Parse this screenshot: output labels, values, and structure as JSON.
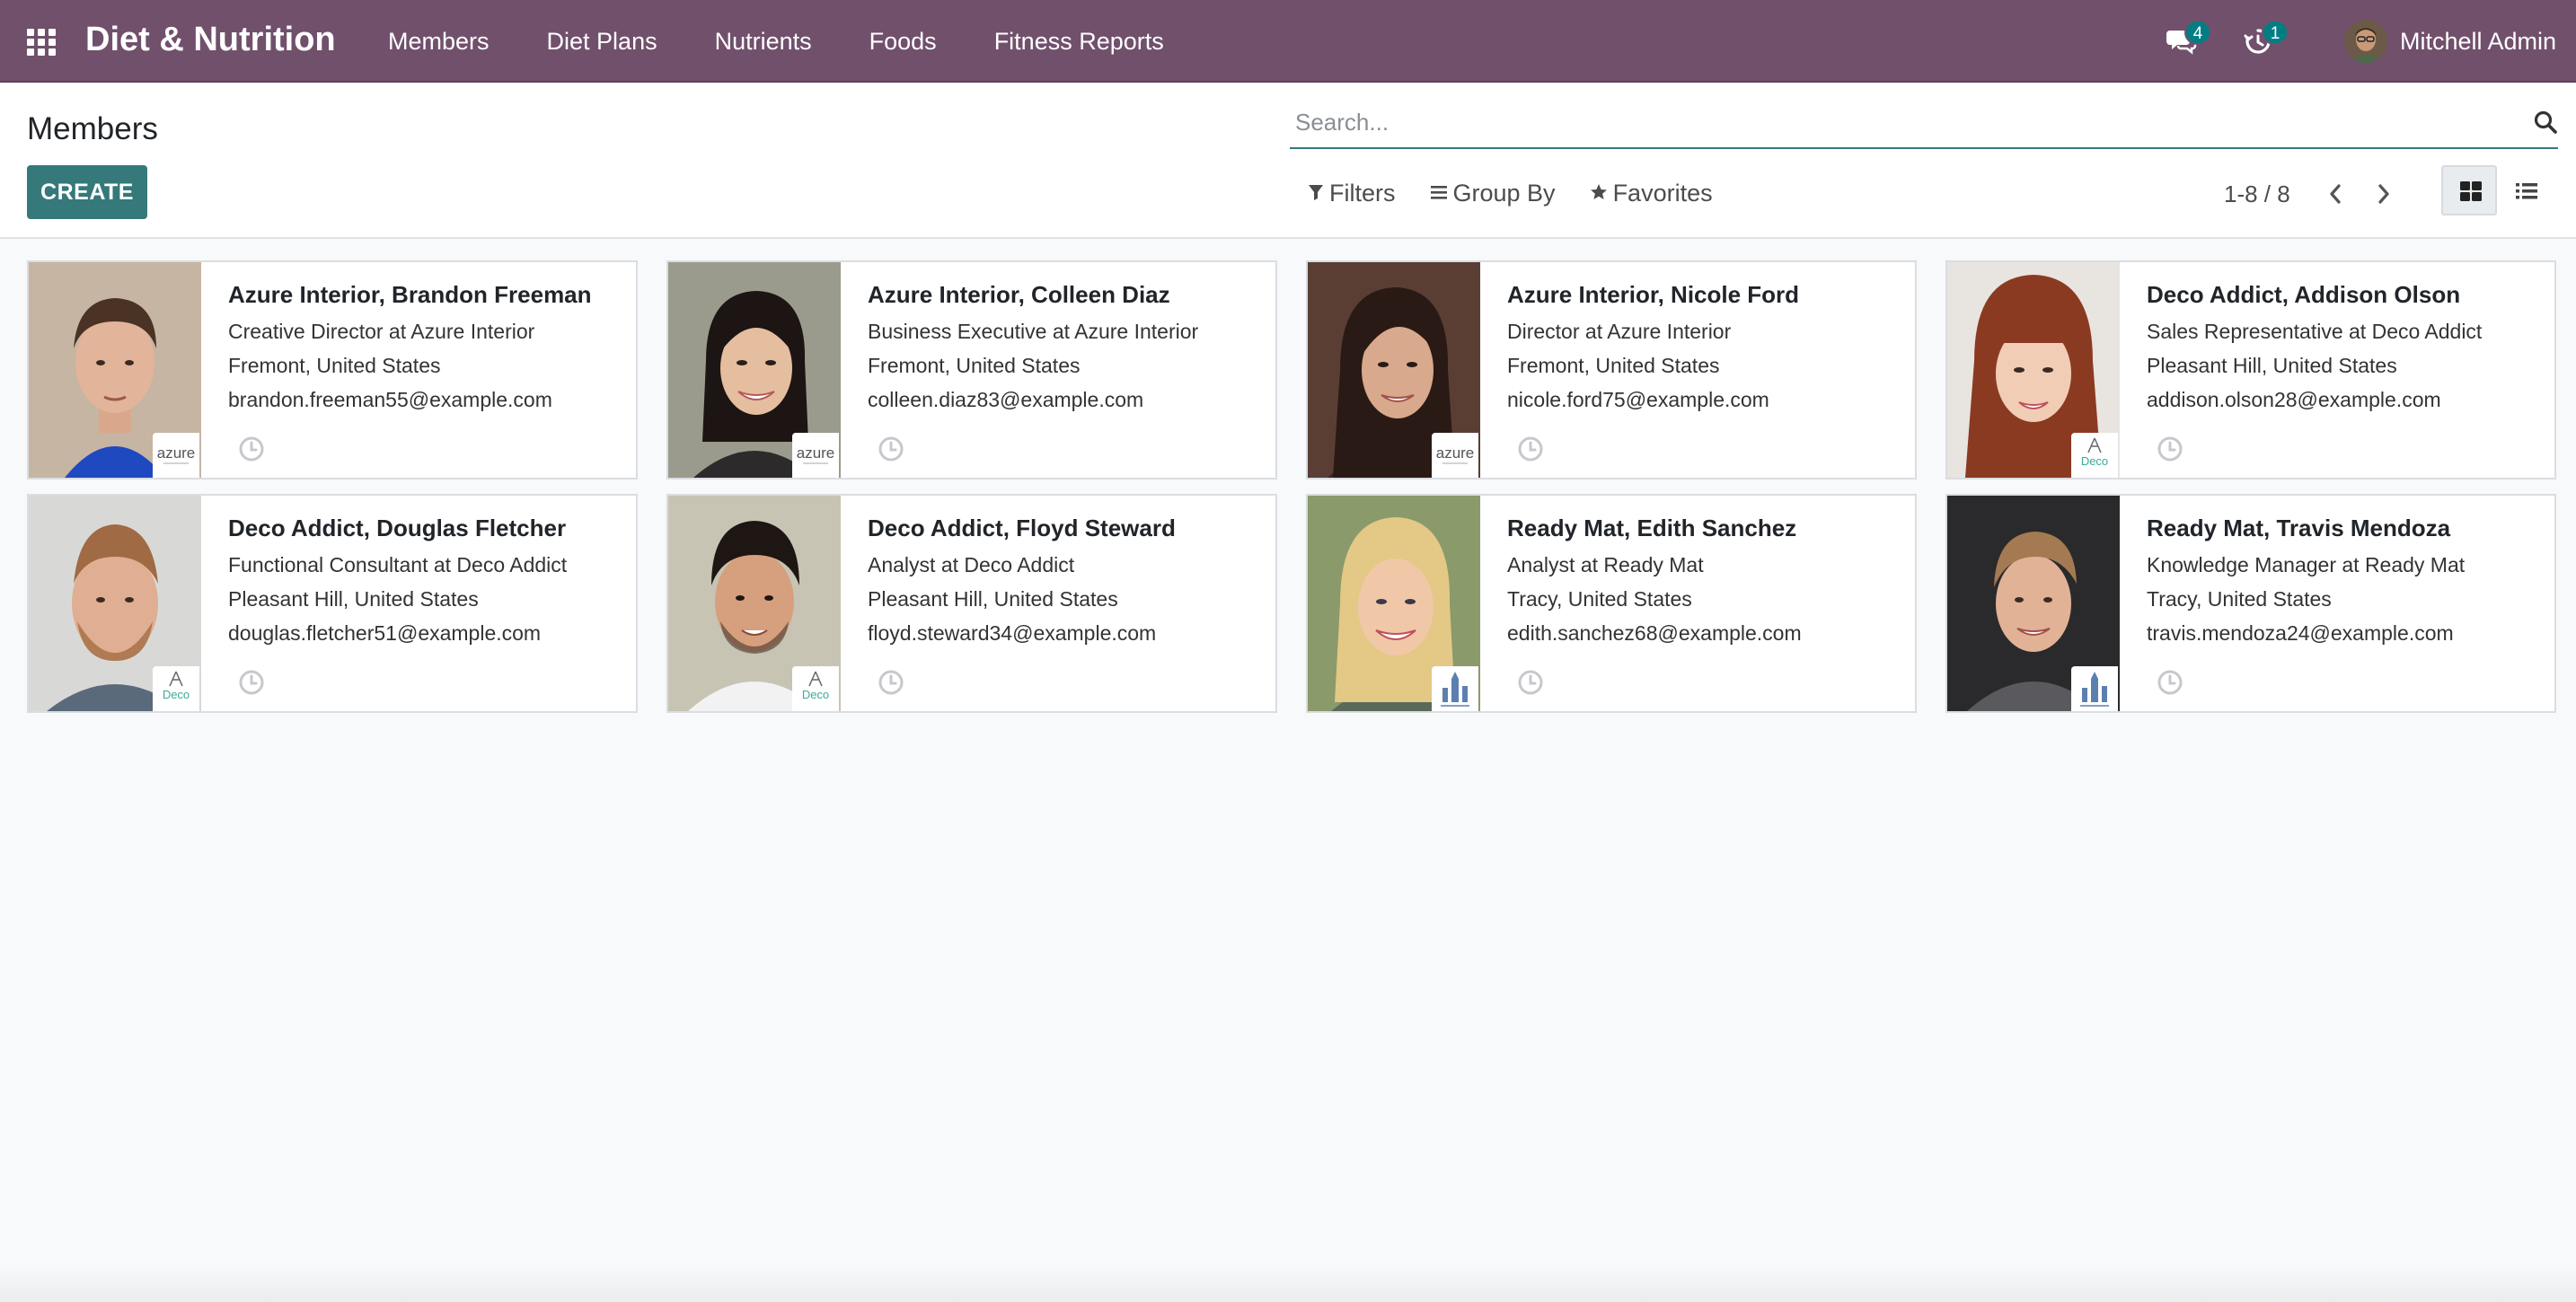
{
  "app": {
    "brand": "Diet & Nutrition",
    "menu": [
      {
        "label": "Members"
      },
      {
        "label": "Diet Plans"
      },
      {
        "label": "Nutrients"
      },
      {
        "label": "Foods"
      },
      {
        "label": "Fitness Reports"
      }
    ],
    "systray": {
      "messages_icon": "chat-icon",
      "messages_count": "4",
      "activities_icon": "clock-icon",
      "activities_count": "1"
    },
    "user": {
      "name": "Mitchell Admin"
    }
  },
  "control_panel": {
    "title": "Members",
    "create_label": "CREATE",
    "search_placeholder": "Search...",
    "filters_label": "Filters",
    "group_by_label": "Group By",
    "favorites_label": "Favorites",
    "pager_value": "1-8 / 8",
    "view_modes": [
      "kanban",
      "list"
    ],
    "active_view": "kanban"
  },
  "colors": {
    "navbar": "#71506c",
    "primary_button": "#35797a",
    "badge": "#017e84",
    "background": "#f8f9fa"
  },
  "members": [
    {
      "name": "Azure Interior, Brandon Freeman",
      "job": "Creative Director at Azure Interior",
      "location": "Fremont, United States",
      "email": "brandon.freeman55@example.com",
      "company_logo": "azure"
    },
    {
      "name": "Azure Interior, Colleen Diaz",
      "job": "Business Executive at Azure Interior",
      "location": "Fremont, United States",
      "email": "colleen.diaz83@example.com",
      "company_logo": "azure"
    },
    {
      "name": "Azure Interior, Nicole Ford",
      "job": "Director at Azure Interior",
      "location": "Fremont, United States",
      "email": "nicole.ford75@example.com",
      "company_logo": "azure"
    },
    {
      "name": "Deco Addict, Addison Olson",
      "job": "Sales Representative at Deco Addict",
      "location": "Pleasant Hill, United States",
      "email": "addison.olson28@example.com",
      "company_logo": "deco"
    },
    {
      "name": "Deco Addict, Douglas Fletcher",
      "job": "Functional Consultant at Deco Addict",
      "location": "Pleasant Hill, United States",
      "email": "douglas.fletcher51@example.com",
      "company_logo": "deco"
    },
    {
      "name": "Deco Addict, Floyd Steward",
      "job": "Analyst at Deco Addict",
      "location": "Pleasant Hill, United States",
      "email": "floyd.steward34@example.com",
      "company_logo": "deco"
    },
    {
      "name": "Ready Mat, Edith Sanchez",
      "job": "Analyst at Ready Mat",
      "location": "Tracy, United States",
      "email": "edith.sanchez68@example.com",
      "company_logo": "readymat"
    },
    {
      "name": "Ready Mat, Travis Mendoza",
      "job": "Knowledge Manager at Ready Mat",
      "location": "Tracy, United States",
      "email": "travis.mendoza24@example.com",
      "company_logo": "readymat"
    }
  ],
  "logo_text": {
    "azure": "azure",
    "deco": "Deco"
  }
}
